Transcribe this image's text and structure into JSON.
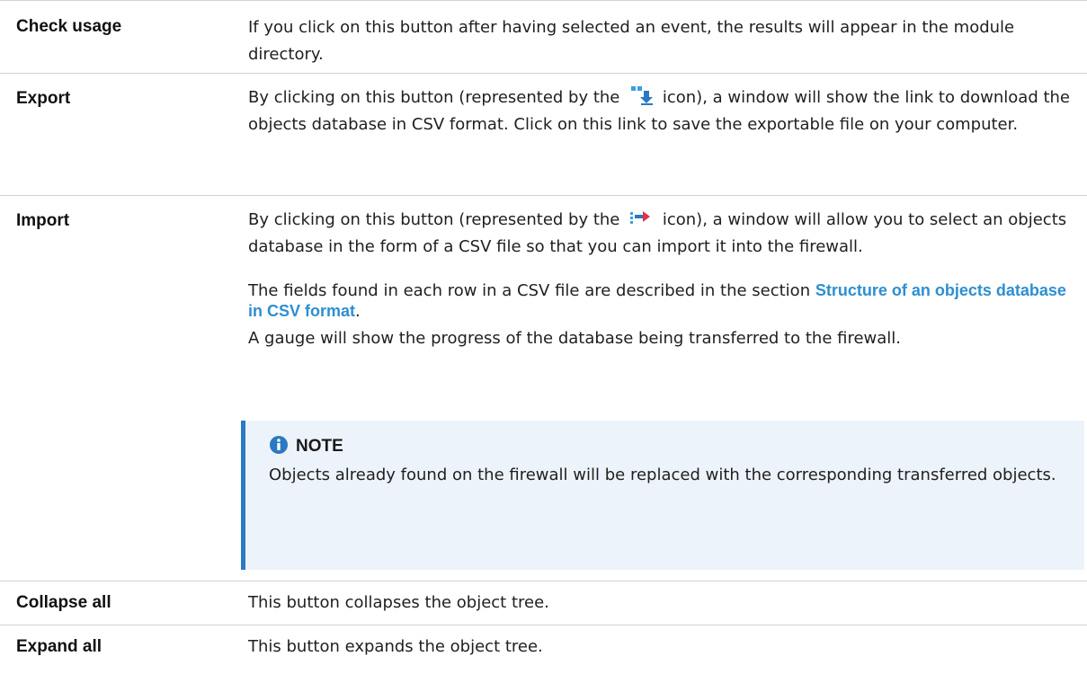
{
  "rows": [
    {
      "term": "Check usage",
      "desc": "If you click on this button after having selected an event, the results will appear in the module directory."
    },
    {
      "term": "Export",
      "desc_before": "By clicking on this button (represented by the",
      "desc_after": "icon), a window will show the link to download the objects database in CSV format. Click on this link to save the exportable file on your computer.",
      "icon": "download-icon"
    },
    {
      "term": "Import",
      "desc_before": "By clicking on this button (represented by the",
      "desc_after": "icon), a window will allow you to select an objects database in the form of a CSV file so that you can import it into the firewall.",
      "icon": "import-icon",
      "para2_before": "The fields found in each row in a CSV file are described in the section",
      "para2_link": "Structure of an objects database in CSV format",
      "para2_after": ".",
      "para3": "A gauge will show the progress of the database being transferred to the firewall.",
      "note": {
        "title": "NOTE",
        "icon": "info-icon",
        "body": "Objects already found on the firewall will be replaced with the corresponding transferred objects."
      }
    },
    {
      "term": "Collapse all",
      "desc": "This button collapses the object tree."
    },
    {
      "term": "Expand all",
      "desc": "This button expands the object tree."
    }
  ],
  "colors": {
    "link": "#2d8fd1",
    "note_bg": "#edf3fa",
    "note_border": "#2b79c2",
    "divider": "#d2d2d2"
  }
}
